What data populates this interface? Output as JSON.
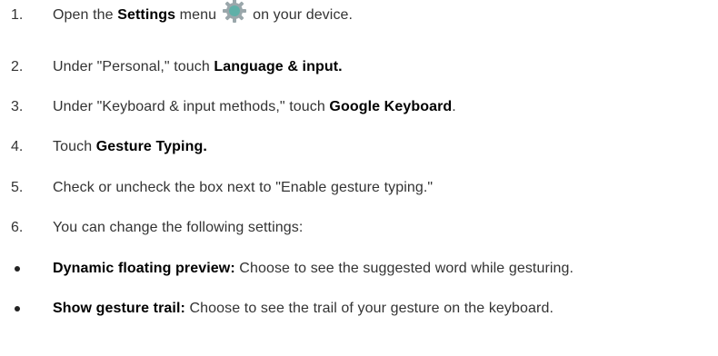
{
  "steps": [
    {
      "number": "1.",
      "before": "Open the ",
      "bold": "Settings",
      "middle": " menu",
      "icon": "settings-gear-icon",
      "after": "on your device."
    },
    {
      "number": "2.",
      "before": "Under \"Personal,\" touch ",
      "bold": "Language & input.",
      "after": ""
    },
    {
      "number": "3.",
      "before": "Under \"Keyboard & input methods,\" touch ",
      "bold": "Google Keyboard",
      "after": "."
    },
    {
      "number": "4.",
      "before": "Touch ",
      "bold": "Gesture Typing.",
      "after": ""
    },
    {
      "number": "5.",
      "text": "Check or uncheck the box next to \"Enable gesture typing.\""
    },
    {
      "number": "6.",
      "text": "You can change the following settings:"
    }
  ],
  "bullets": [
    {
      "bold": "Dynamic floating preview:",
      "text": " Choose to see the suggested word while gesturing."
    },
    {
      "bold": "Show gesture trail:",
      "text": " Choose to see the trail of your gesture on the keyboard."
    }
  ],
  "colors": {
    "text": "#333333",
    "icon_teal": "#5fb0a8",
    "icon_gray": "#9aa7ab"
  }
}
